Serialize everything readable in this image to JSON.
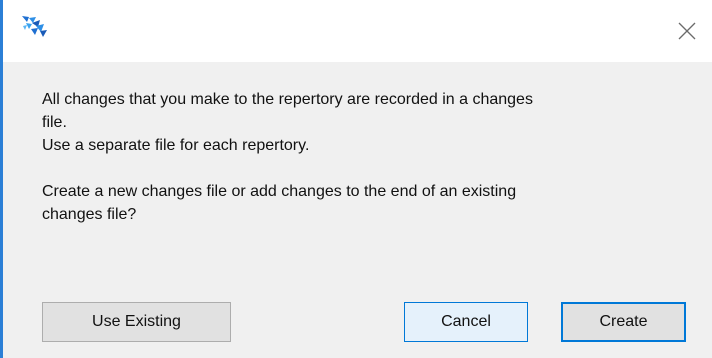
{
  "window": {
    "app_icon": "app-logo-icon",
    "close_icon": "close-icon"
  },
  "message": {
    "line1": "All changes that you make to the repertory are recorded in a changes",
    "line2": "file.",
    "line3": "Use a separate file for each repertory.",
    "line4": "Create a new changes file or add changes to the end of an existing",
    "line5": "changes file?"
  },
  "buttons": {
    "use_existing": "Use Existing",
    "cancel": "Cancel",
    "create": "Create"
  },
  "colors": {
    "accent": "#0078d7",
    "content_background": "#f0f0f0",
    "button_face": "#e1e1e1",
    "button_hover": "#e5f1fb"
  }
}
